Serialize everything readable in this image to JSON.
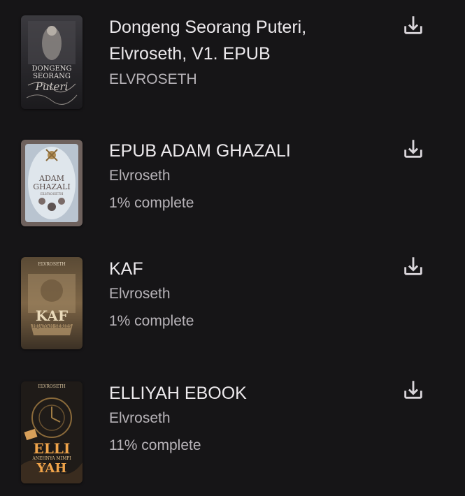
{
  "colors": {
    "background": "#161517",
    "title_text": "#ece9ec",
    "secondary_text": "#b7b3b8",
    "icon": "#d9d5da"
  },
  "books": [
    {
      "title": "Dongeng Seorang Puteri, Elvroseth, V1. EPUB",
      "author": "ELVROSETH",
      "progress": "",
      "cover_text": [
        "DONGENG",
        "SEORANG",
        "Puteri"
      ],
      "action_icon": "download-icon"
    },
    {
      "title": "EPUB ADAM GHAZALI",
      "author": "Elvroseth",
      "progress": "1% complete",
      "cover_text": [
        "ADAM",
        "GHAZALI",
        "ELVROSETH"
      ],
      "action_icon": "download-icon"
    },
    {
      "title": "KAF",
      "author": "Elvroseth",
      "progress": "1% complete",
      "cover_text": [
        "ELVROSETH",
        "KAF",
        "HIJAIYAH SERIES"
      ],
      "action_icon": "download-icon"
    },
    {
      "title": "ELLIYAH EBOOK",
      "author": "Elvroseth",
      "progress": "11% complete",
      "cover_text": [
        "ELVROSETH",
        "ELLI",
        "ANEHNYA MIMPI",
        "YAH"
      ],
      "action_icon": "download-icon"
    }
  ]
}
